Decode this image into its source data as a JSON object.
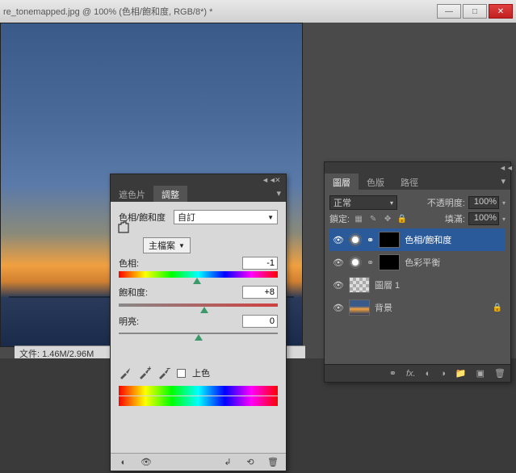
{
  "window": {
    "title": "re_tonemapped.jpg @ 100% (色相/飽和度, RGB/8*) *",
    "min": "—",
    "max": "□",
    "close": "✕"
  },
  "status": "文件: 1.46M/2.96M",
  "adjust": {
    "tabs": {
      "swatches": "遮色片",
      "adjustments": "調整"
    },
    "type_label": "色相/飽和度",
    "preset": "自訂",
    "master": "主檔案",
    "hue": {
      "label": "色相:",
      "value": "-1"
    },
    "saturation": {
      "label": "飽和度:",
      "value": "+8"
    },
    "lightness": {
      "label": "明亮:",
      "value": "0"
    },
    "colorize": "上色",
    "collapse": "◄◄",
    "close": "✕",
    "menu": "▾"
  },
  "layers": {
    "tabs": {
      "layers": "圖層",
      "channels": "色版",
      "paths": "路徑"
    },
    "blend": "正常",
    "opacity_label": "不透明度:",
    "opacity": "100%",
    "lock_label": "鎖定:",
    "fill_label": "填滿:",
    "fill": "100%",
    "items": [
      {
        "name": "色相/飽和度"
      },
      {
        "name": "色彩平衡"
      },
      {
        "name": "圖層 1"
      },
      {
        "name": "背景"
      }
    ],
    "collapse": "◄◄",
    "menu": "▾"
  }
}
